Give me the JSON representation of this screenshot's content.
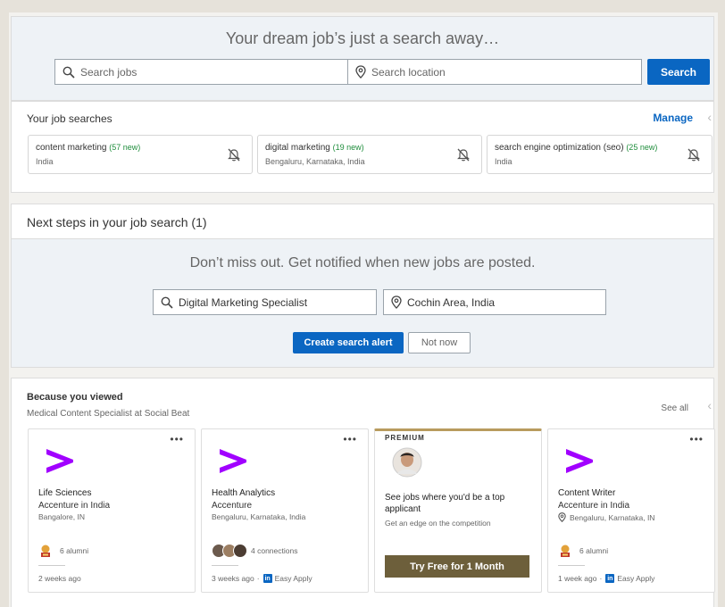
{
  "hero": {
    "title": "Your dream job’s just a search away…",
    "search_jobs_placeholder": "Search jobs",
    "search_location_placeholder": "Search location",
    "search_button": "Search"
  },
  "job_searches": {
    "title": "Your job searches",
    "manage": "Manage",
    "items": [
      {
        "name": "content marketing",
        "new": "(57 new)",
        "location": "India"
      },
      {
        "name": "digital marketing",
        "new": "(19 new)",
        "location": "Bengaluru, Karnataka, India"
      },
      {
        "name": "search engine optimization (seo)",
        "new": "(25 new)",
        "location": "India"
      }
    ]
  },
  "next_steps": {
    "title": "Next steps in your job search (1)",
    "heading": "Don’t miss out. Get notified when new jobs are posted.",
    "keyword_value": "Digital Marketing Specialist",
    "location_value": "Cochin Area, India",
    "create_alert": "Create search alert",
    "not_now": "Not now"
  },
  "because_viewed": {
    "title": "Because you viewed",
    "subtitle": "Medical Content Specialist at Social Beat",
    "see_all": "See all",
    "jobs": [
      {
        "title": "Life Sciences",
        "company": "Accenture in India",
        "location": "Bangalore, IN",
        "social": "6 alumni",
        "posted": "2 weeks ago",
        "easy_apply": ""
      },
      {
        "title": "Health Analytics",
        "company": "Accenture",
        "location": "Bengaluru, Karnataka, India",
        "social": "4 connections",
        "posted": "3 weeks ago",
        "easy_apply": "Easy Apply"
      },
      {
        "title": "Content Writer",
        "company": "Accenture in India",
        "location": "Bengaluru, Karnataka, IN",
        "social": "6 alumni",
        "posted": "1 week ago",
        "easy_apply": "Easy Apply"
      }
    ],
    "premium": {
      "label": "PREMIUM",
      "text": "See jobs where you'd be a top applicant",
      "sub": "Get an edge on the competition",
      "button": "Try Free for 1 Month"
    }
  },
  "colors": {
    "accent": "#0a66c2",
    "brand_logo": "#a100ff",
    "premium_gold": "#6d5f3b",
    "new_green": "#1f8d3c"
  }
}
